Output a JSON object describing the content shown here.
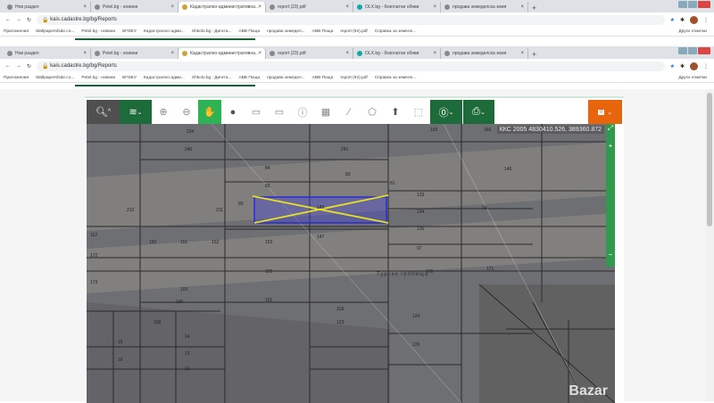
{
  "browser": {
    "tabs": [
      {
        "label": "Нов раздел"
      },
      {
        "label": "Petel.bg - новини"
      },
      {
        "label": "Кадастрално-административна..."
      },
      {
        "label": "report (23).pdf"
      },
      {
        "label": "OLX.bg - безплатни обяви"
      },
      {
        "label": "продава земеделска земя"
      }
    ],
    "active_tab": 2,
    "url": "kais.cadastre.bg/bg/Reports",
    "bookmarks": [
      "Приложения",
      "Wallpapershide.co...",
      "Petel.bg - новини",
      "БПЗЕУ",
      "Кадастрално-адми...",
      "Shkolo.bg : Дигита...",
      "ABB Поща",
      "продава земедел...",
      "ABB Поща",
      "report (92).pdf",
      "Справка за земеле..."
    ],
    "other_bookmarks": "Други отметки"
  },
  "toolbar": {
    "tools": [
      "search",
      "layers",
      "zoom-in",
      "zoom-out",
      "pan",
      "globe",
      "rect-add",
      "rect-remove",
      "info",
      "measure-select",
      "ruler",
      "polygon",
      "upload",
      "select-area",
      "identify",
      "print"
    ],
    "menu_badge": "0"
  },
  "map": {
    "coordinates": "ККС 2005 4830410.526, 389360.872",
    "zoom_in": "+",
    "zoom_out": "−",
    "parcel_labels": [
      "234",
      "193",
      "166",
      "240",
      "241",
      "84",
      "146",
      "83",
      "82",
      "81",
      "112",
      "211",
      "212",
      "80",
      "145",
      "133",
      "134",
      "135",
      "79",
      "147",
      "172",
      "150",
      "151",
      "152",
      "153",
      "97",
      "173",
      "171",
      "103",
      "102",
      "170",
      "101",
      "100",
      "109",
      "118",
      "123",
      "124",
      "126",
      "14",
      "13",
      "12",
      "15",
      "16"
    ],
    "locality": "Турски гробища",
    "selection_color": "#2a2ad8",
    "cross_color": "#e8e020"
  },
  "watermark": "Bazar"
}
